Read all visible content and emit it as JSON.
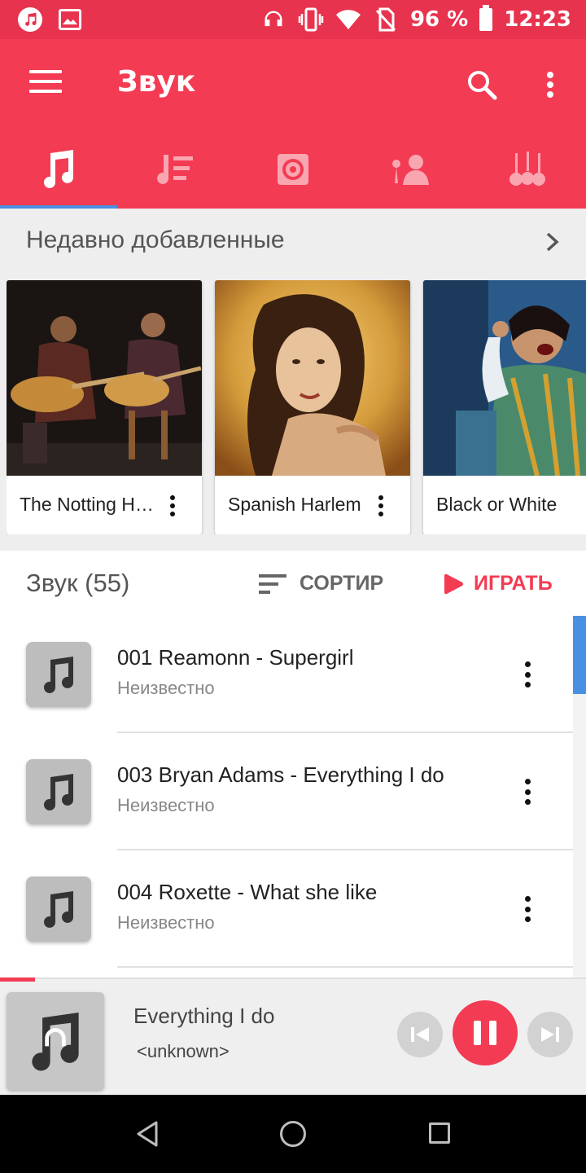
{
  "status_bar": {
    "battery": "96 %",
    "time": "12:23",
    "icons": [
      "music-app-icon",
      "image-icon",
      "headphones-icon",
      "vibrate-icon",
      "wifi-icon",
      "no-sim-icon",
      "battery-icon"
    ]
  },
  "app_bar": {
    "title": "Звук",
    "icons": [
      "menu-icon",
      "search-icon",
      "more-vert-icon"
    ]
  },
  "tabs": [
    {
      "name": "songs",
      "icon": "music-note-icon",
      "active": true
    },
    {
      "name": "playlists",
      "icon": "playlist-icon",
      "active": false
    },
    {
      "name": "albums",
      "icon": "album-icon",
      "active": false
    },
    {
      "name": "artists",
      "icon": "artist-icon",
      "active": false
    },
    {
      "name": "genres",
      "icon": "guitars-icon",
      "active": false
    }
  ],
  "recent": {
    "title": "Недавно добавленные",
    "cards": [
      {
        "label": "The Notting Hillbillies"
      },
      {
        "label": "Spanish Harlem"
      },
      {
        "label": "Black or White"
      }
    ]
  },
  "list": {
    "count_label": "Звук (55)",
    "sort_label": "СОРТИР",
    "play_label": "ИГРАТЬ"
  },
  "songs": [
    {
      "title": "001 Reamonn - Supergirl",
      "subtitle": "Неизвестно"
    },
    {
      "title": "003 Bryan Adams - Everything I do",
      "subtitle": "Неизвестно"
    },
    {
      "title": "004 Roxette - What she like",
      "subtitle": "Неизвестно"
    }
  ],
  "now_playing": {
    "title": "Everything I do",
    "artist": "<unknown>",
    "progress": 0.06
  },
  "colors": {
    "accent": "#f33b53",
    "status_bar": "#e8334f",
    "tab_indicator": "#4a90e2"
  }
}
